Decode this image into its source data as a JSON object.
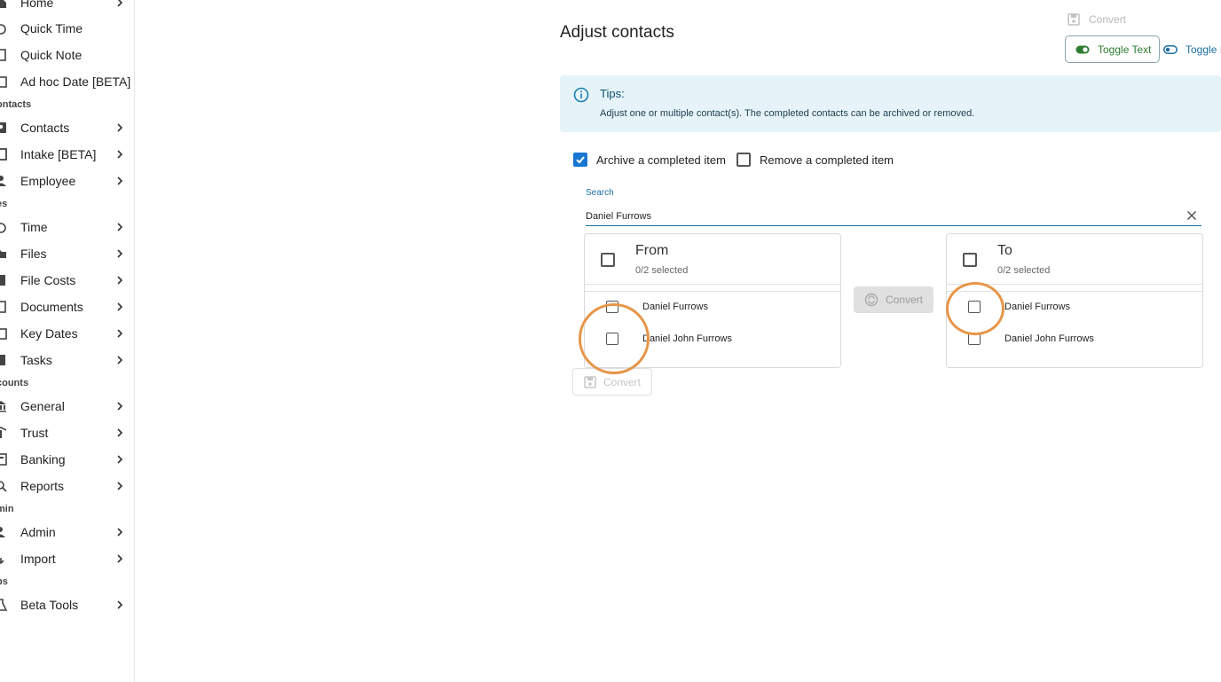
{
  "sidebar": {
    "items": [
      {
        "label": "Home",
        "icon": "home-icon",
        "chevron": true
      },
      {
        "label": "Quick Time",
        "icon": "stopwatch-icon",
        "chevron": false
      },
      {
        "label": "Quick Note",
        "icon": "note-icon",
        "chevron": false
      },
      {
        "label": "Ad hoc Date [BETA]",
        "icon": "calendar-icon",
        "chevron": false
      },
      {
        "label": "Contacts",
        "icon": "contacts-icon",
        "chevron": true
      },
      {
        "label": "Intake [BETA]",
        "icon": "intake-icon",
        "chevron": true
      },
      {
        "label": "Employee",
        "icon": "employee-icon",
        "chevron": true
      },
      {
        "label": "Time",
        "icon": "stopwatch-icon",
        "chevron": true
      },
      {
        "label": "Files",
        "icon": "files-icon",
        "chevron": true
      },
      {
        "label": "File Costs",
        "icon": "file-costs-icon",
        "chevron": true
      },
      {
        "label": "Documents",
        "icon": "documents-icon",
        "chevron": true
      },
      {
        "label": "Key Dates",
        "icon": "calendar-icon",
        "chevron": true
      },
      {
        "label": "Tasks",
        "icon": "tasks-icon",
        "chevron": true
      },
      {
        "label": "General",
        "icon": "bank-icon",
        "chevron": true
      },
      {
        "label": "Trust",
        "icon": "trust-icon",
        "chevron": true
      },
      {
        "label": "Banking",
        "icon": "banking-icon",
        "chevron": true
      },
      {
        "label": "Reports",
        "icon": "reports-icon",
        "chevron": true
      },
      {
        "label": "Admin",
        "icon": "admin-icon",
        "chevron": true
      },
      {
        "label": "Import",
        "icon": "import-icon",
        "chevron": true
      },
      {
        "label": "Beta Tools",
        "icon": "beta-tools-icon",
        "chevron": true
      }
    ],
    "sections": [
      "ontacts",
      "es",
      "counts",
      "min",
      "bs"
    ]
  },
  "main": {
    "title": "Adjust contacts",
    "top_convert_label": "Convert",
    "toggle_text_label": "Toggle Text",
    "toggle_icons_label": "Toggle I",
    "tips_title": "Tips:",
    "tips_body": "Adjust one or multiple contact(s). The completed contacts can be archived or removed.",
    "archive_label": "Archive a completed item",
    "archive_checked": true,
    "remove_label": "Remove a completed item",
    "remove_checked": false,
    "search_label": "Search",
    "search_value": "Daniel Furrows",
    "from_panel": {
      "title": "From",
      "selected": "0/2 selected",
      "items": [
        "Daniel Furrows",
        "Daniel John Furrows"
      ]
    },
    "to_panel": {
      "title": "To",
      "selected": "0/2 selected",
      "items": [
        "Daniel Furrows",
        "Daniel John Furrows"
      ]
    },
    "mid_convert_label": "Convert",
    "bottom_convert_label": "Convert"
  },
  "colors": {
    "accent": "#1976d2",
    "tips_bg": "#e6f4fa",
    "highlight_ring": "#e69548",
    "toggle_green": "#2e7d32"
  }
}
